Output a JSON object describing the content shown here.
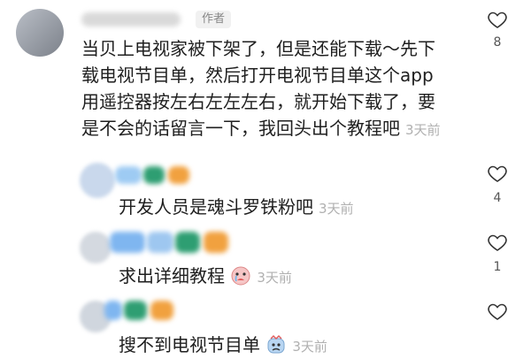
{
  "main_comment": {
    "badge": "作者",
    "lines": [
      "当贝上电视家被下架了，但是还能下载～先下",
      "载电视节目单，然后打开电视节目单这个app",
      "用遥控器按左右左左左右，就开始下载了，要",
      "是不会的话留言一下，我回头出个教程吧"
    ],
    "time": "3天前",
    "likes": "8"
  },
  "replies": [
    {
      "text": "开发人员是魂斗罗铁粉吧",
      "time": "3天前",
      "likes": "4",
      "emoji": ""
    },
    {
      "text": "求出详细教程",
      "time": "3天前",
      "likes": "1",
      "emoji": "crying-face-icon"
    },
    {
      "text": "搜不到电视节目单",
      "time": "3天前",
      "likes": "",
      "emoji": "sad-face-icon"
    }
  ],
  "colors": {
    "avatar_main": "#8a8f99",
    "blur_blue": "#7fb6f0",
    "blur_green": "#2e9e72",
    "blur_orange": "#f1a13f",
    "time": "#b0b0b0"
  }
}
